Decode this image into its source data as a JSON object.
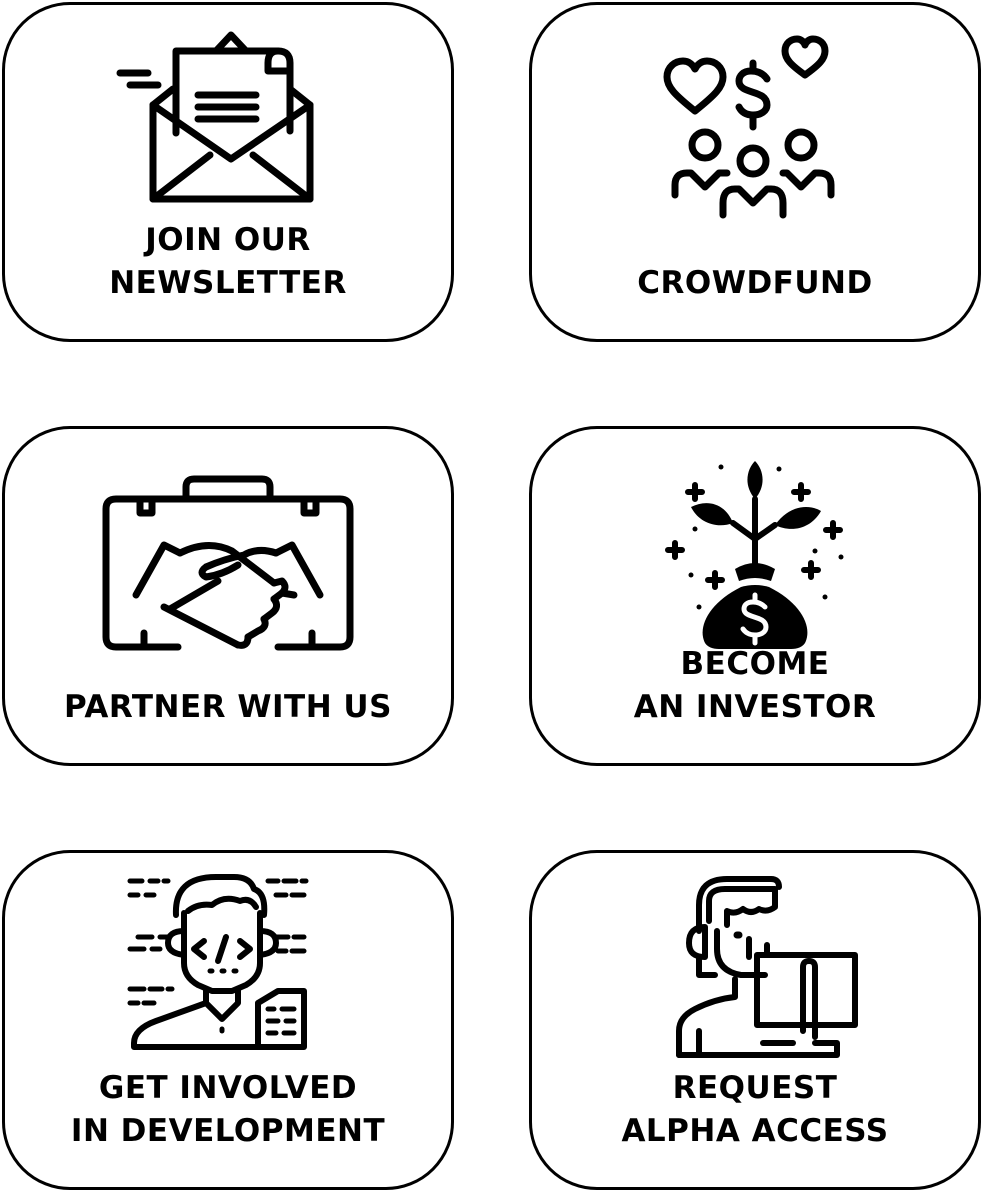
{
  "colors": {
    "stroke": "#000000",
    "background": "#ffffff"
  },
  "cards": [
    {
      "icon": "envelope-letter-icon",
      "lines": [
        "JOIN OUR",
        "NEWSLETTER"
      ]
    },
    {
      "icon": "crowd-hearts-dollar-icon",
      "lines": [
        "CROWDFUND"
      ]
    },
    {
      "icon": "briefcase-handshake-icon",
      "lines": [
        "PARTNER WITH US"
      ]
    },
    {
      "icon": "money-bag-plant-icon",
      "lines": [
        "BECOME",
        "AN INVESTOR"
      ]
    },
    {
      "icon": "developer-code-icon",
      "lines": [
        "GET INVOLVED",
        "IN DEVELOPMENT"
      ]
    },
    {
      "icon": "support-agent-monitor-icon",
      "lines": [
        "REQUEST",
        "ALPHA ACCESS"
      ]
    }
  ]
}
